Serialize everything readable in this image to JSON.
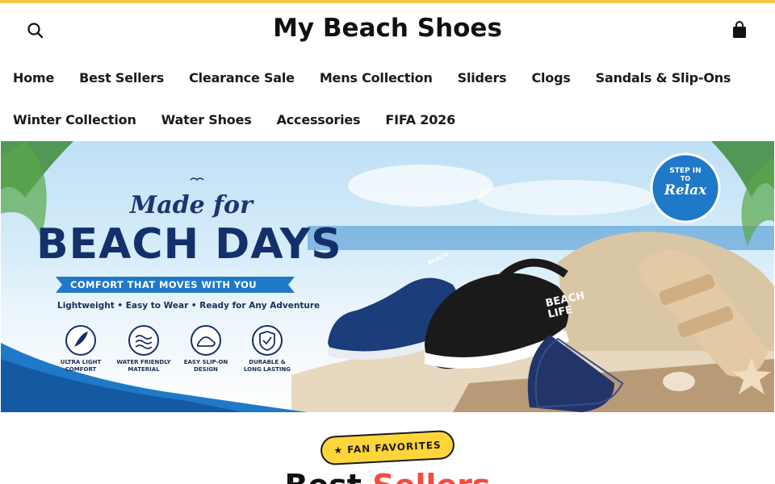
{
  "colors": {
    "topbar": "#f2c94c",
    "accent": "#f24c3d",
    "badge": "#ffd53a",
    "hero_navy": "#14306b",
    "hero_blue": "#1f78c8"
  },
  "header": {
    "search_icon": "search-icon",
    "logo": "My Beach Shoes",
    "cart_icon": "shopping-bag-icon"
  },
  "nav": {
    "row1": [
      "Home",
      "Best Sellers",
      "Clearance Sale",
      "Mens Collection",
      "Sliders",
      "Clogs",
      "Sandals & Slip-Ons"
    ],
    "row2": [
      "Winter Collection",
      "Water Shoes",
      "Accessories",
      "FIFA 2026"
    ]
  },
  "hero": {
    "script_title": "Made for",
    "main_title": "BEACH DAYS",
    "ribbon": "COMFORT THAT MOVES WITH YOU",
    "tagline": "Lightweight • Easy to Wear • Ready for Any Adventure",
    "features": [
      {
        "icon": "feather-icon",
        "line1": "ULTRA LIGHT",
        "line2": "COMFORT"
      },
      {
        "icon": "waves-icon",
        "line1": "WATER FRIENDLY",
        "line2": "MATERIAL"
      },
      {
        "icon": "shoe-icon",
        "line1": "EASY SLIP-ON",
        "line2": "DESIGN"
      },
      {
        "icon": "shield-check-icon",
        "line1": "DURABLE &",
        "line2": "LONG LASTING"
      }
    ],
    "stamp": {
      "line1": "STEP IN",
      "line2": "TO",
      "line3": "Relax"
    },
    "slide_text": {
      "line1": "BEACH",
      "line2": "LIFE"
    },
    "shoe_brand": "BEACH"
  },
  "section": {
    "badge_icon": "star-icon",
    "badge_label": "FAN FAVORITES",
    "title_part1": "Best",
    "title_part2": "Sellers"
  }
}
